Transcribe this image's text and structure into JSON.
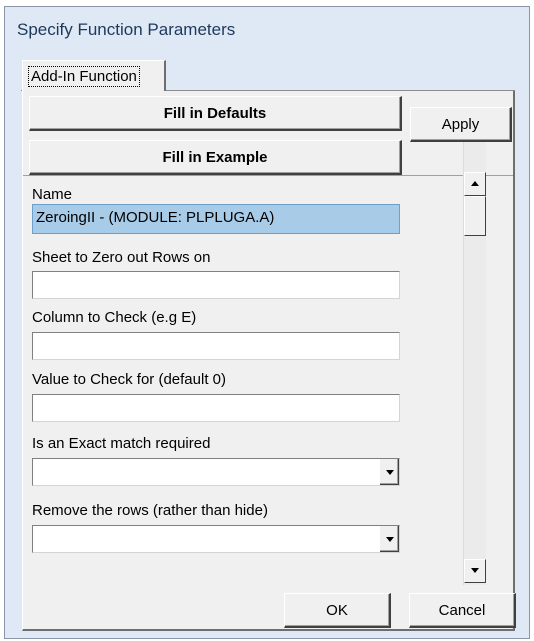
{
  "window": {
    "title": "Specify Function Parameters"
  },
  "tabs": [
    {
      "label": "Add-In Function",
      "active": true
    }
  ],
  "buttons": {
    "fill_defaults": "Fill in Defaults",
    "fill_example": "Fill in Example",
    "apply": "Apply",
    "ok": "OK",
    "cancel": "Cancel"
  },
  "fields": {
    "name": {
      "label": "Name",
      "value": "ZeroingII - (MODULE: PLPLUGA.A)"
    },
    "sheet": {
      "label": "Sheet to Zero out Rows on",
      "value": ""
    },
    "column": {
      "label": "Column to Check (e.g E)",
      "value": ""
    },
    "value_check": {
      "label": "Value to Check for (default 0)",
      "value": ""
    },
    "exact_match": {
      "label": "Is an Exact match required",
      "value": ""
    },
    "remove_rows": {
      "label": "Remove the rows (rather than hide)",
      "value": ""
    }
  },
  "colors": {
    "window_frame": "#dfe9f5",
    "title_text": "#1e395b",
    "selection": "#a8cce8",
    "face": "#f0f0f0"
  }
}
